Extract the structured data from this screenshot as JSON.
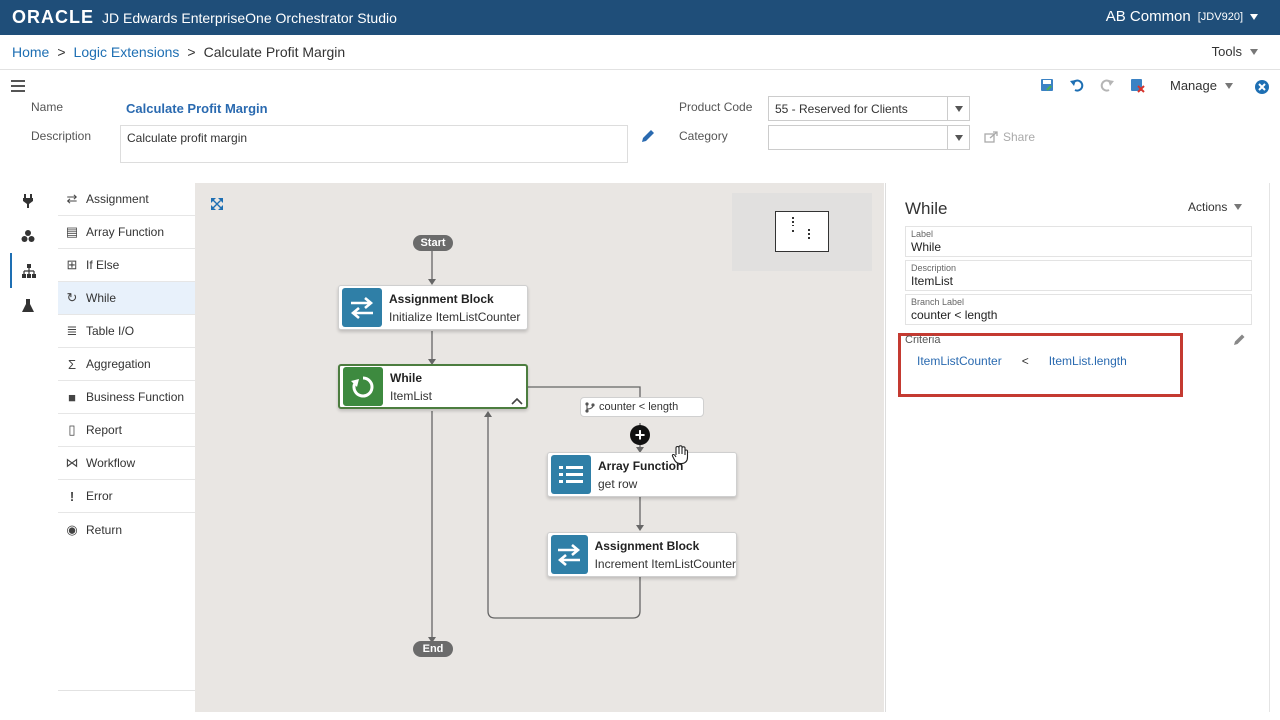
{
  "header": {
    "brand": "ORACLE",
    "app_title": "JD Edwards EnterpriseOne Orchestrator Studio",
    "user": "AB Common",
    "env": "[JDV920]"
  },
  "breadcrumb": {
    "home": "Home",
    "sep": ">",
    "section": "Logic Extensions",
    "current": "Calculate Profit Margin"
  },
  "tools_label": "Tools",
  "form": {
    "name_label": "Name",
    "name_value": "Calculate Profit Margin",
    "description_label": "Description",
    "description_value": "Calculate profit margin",
    "product_code_label": "Product Code",
    "product_code_value": "55 - Reserved for Clients",
    "category_label": "Category",
    "category_value": "",
    "share_label": "Share"
  },
  "toolbar": {
    "manage_label": "Manage",
    "colors": {
      "save": "#3b82c4",
      "undo": "#1e6fb3",
      "redo": "#b5b5b5",
      "delete": "#3b82c4",
      "close": "#1e6fb3"
    }
  },
  "palette": {
    "items": [
      {
        "label": "Assignment",
        "icon": "swap-arrows-icon"
      },
      {
        "label": "Array Function",
        "icon": "list-icon"
      },
      {
        "label": "If Else",
        "icon": "hierarchy-icon"
      },
      {
        "label": "While",
        "icon": "loop-icon",
        "selected": true
      },
      {
        "label": "Table I/O",
        "icon": "database-icon"
      },
      {
        "label": "Aggregation",
        "icon": "sigma-icon"
      },
      {
        "label": "Business Function",
        "icon": "briefcase-icon"
      },
      {
        "label": "Report",
        "icon": "report-icon"
      },
      {
        "label": "Workflow",
        "icon": "workflow-icon"
      },
      {
        "label": "Error",
        "icon": "exclamation-icon"
      },
      {
        "label": "Return",
        "icon": "return-icon"
      }
    ]
  },
  "canvas": {
    "start_label": "Start",
    "end_label": "End",
    "nodes": [
      {
        "title": "Assignment Block",
        "subtitle": "Initialize ItemListCounter",
        "icon": "swap-arrows-icon",
        "color": "#2f7fa7"
      },
      {
        "title": "While",
        "subtitle": "ItemList",
        "icon": "loop-icon",
        "color": "#3d8a3f"
      },
      {
        "title": "Array Function",
        "subtitle": "get row",
        "icon": "list-icon",
        "color": "#2f7fa7"
      },
      {
        "title": "Assignment Block",
        "subtitle": "Increment ItemListCounter",
        "icon": "swap-arrows-icon",
        "color": "#2f7fa7"
      }
    ],
    "branch_label": "counter < length",
    "add_symbol": "+"
  },
  "panel": {
    "title": "While",
    "actions_label": "Actions",
    "label_caption": "Label",
    "label_value": "While",
    "description_caption": "Description",
    "description_value": "ItemList",
    "branch_caption": "Branch Label",
    "branch_value": "counter < length",
    "criteria_label": "Criteria",
    "criteria": {
      "left": "ItemListCounter",
      "operator": "<",
      "right": "ItemList.length"
    },
    "highlight_color": "#c43a31"
  }
}
